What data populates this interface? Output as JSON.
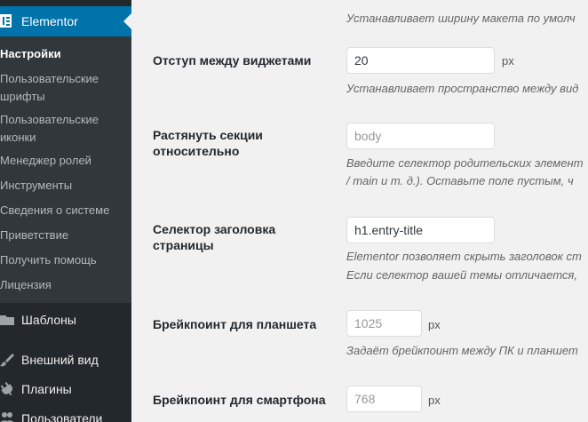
{
  "sidebar": {
    "active_menu": "Elementor",
    "submenu": [
      {
        "label": "Настройки",
        "current": true
      },
      {
        "label": "Пользовательские шрифты"
      },
      {
        "label": "Пользовательские иконки"
      },
      {
        "label": "Менеджер ролей"
      },
      {
        "label": "Инструменты"
      },
      {
        "label": "Сведения о системе"
      },
      {
        "label": "Приветствие"
      },
      {
        "label": "Получить помощь"
      },
      {
        "label": "Лицензия"
      }
    ],
    "menu": [
      {
        "label": "Шаблоны",
        "icon": "folder-icon"
      },
      {
        "label": "Внешний вид",
        "icon": "paintbrush-icon"
      },
      {
        "label": "Плагины",
        "icon": "plugin-icon"
      },
      {
        "label": "Пользователи",
        "icon": "users-icon"
      }
    ]
  },
  "settings": {
    "top_desc": "Устанавливает ширину макета по умолч",
    "widget_space": {
      "label": "Отступ между виджетами",
      "value": "20",
      "unit": "px",
      "desc": "Устанавливает пространство между вид"
    },
    "stretch_section": {
      "label": "Растянуть секции относительно",
      "placeholder": "body",
      "desc_line1": "Введите селектор родительских элемент",
      "desc_line2": "/ main и т. д.). Оставьте поле пустым, ч"
    },
    "page_title": {
      "label": "Селектор заголовка страницы",
      "value": "h1.entry-title",
      "desc_line1": "Elementor позволяет скрыть заголовок ст",
      "desc_line2": "Если селектор вашей темы отличается,"
    },
    "tablet_bp": {
      "label": "Брейкпоинт для планшета",
      "placeholder": "1025",
      "unit": "px",
      "desc": "Задаёт брейкпоинт между ПК и планшет"
    },
    "mobile_bp": {
      "label": "Брейкпоинт для смартфона",
      "placeholder": "768",
      "unit": "px"
    }
  }
}
